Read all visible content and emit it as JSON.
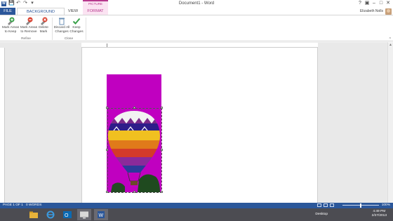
{
  "window": {
    "title": "Document1 - Word",
    "app_icon": "W",
    "quick_access": [
      "save-icon",
      "undo-icon",
      "redo-icon",
      "customize-icon"
    ],
    "controls": [
      "?",
      "▣",
      "–",
      "□",
      "✕"
    ]
  },
  "context": {
    "group_label": "PICTURE TOOLS",
    "tab_label": "FORMAT"
  },
  "tabs": {
    "file": "FILE",
    "background_removal": "BACKGROUND REMOVAL",
    "view": "VIEW"
  },
  "user": {
    "name": "Elizabeth Nolls"
  },
  "ribbon": {
    "refine": {
      "label": "Refine",
      "mark_keep": "Mark Areas\nto Keep",
      "mark_remove": "Mark Areas\nto Remove",
      "delete_mark": "Delete\nMark"
    },
    "close": {
      "label": "Close",
      "discard": "Discard All\nChanges",
      "keep": "Keep\nChanges"
    }
  },
  "status": {
    "page": "PAGE 1 OF 1",
    "words": "0 WORDS",
    "zoom": "100%",
    "zoom_level": 1.0
  },
  "taskbar": {
    "items": [
      "file-explorer-icon",
      "internet-explorer-icon",
      "outlook-icon",
      "desktop-app-icon",
      "word-icon"
    ],
    "desktop_label": "Desktop",
    "time": "4:49 PM",
    "date": "2/27/2013"
  },
  "colors": {
    "word_blue": "#2b579a",
    "picture_tools": "#b7378c",
    "removal_magenta": "#c000c0"
  }
}
